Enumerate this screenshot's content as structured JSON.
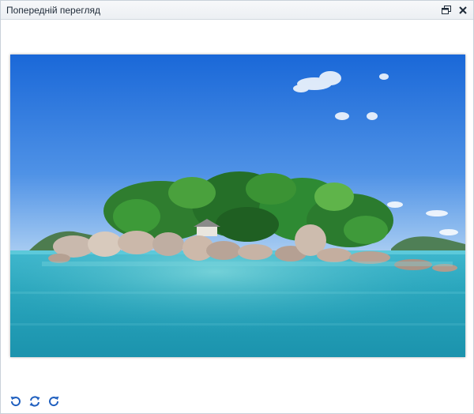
{
  "window": {
    "title": "Попередній перегляд"
  },
  "titlebar_buttons": [
    {
      "icon": "restore-icon"
    },
    {
      "icon": "close-icon"
    }
  ],
  "preview": {
    "image": "tropical-island-photo"
  },
  "toolbar": {
    "buttons": [
      {
        "icon": "rotate-left-icon"
      },
      {
        "icon": "refresh-icon"
      },
      {
        "icon": "rotate-right-icon"
      }
    ]
  },
  "colors": {
    "icon_blue": "#1f5fbf",
    "sky_top": "#1a68d8",
    "sky_bottom": "#7fb4ef",
    "sea_near": "#1f9fb7",
    "sea_far": "#3fc0d3"
  }
}
